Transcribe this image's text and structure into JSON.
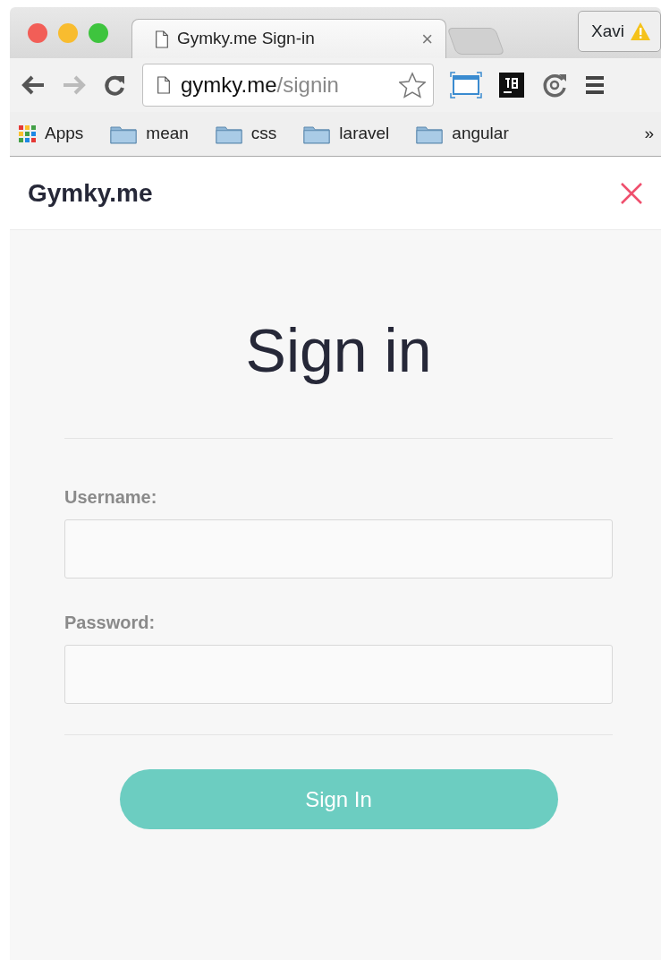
{
  "browser": {
    "tab": {
      "title": "Gymky.me Sign-in",
      "close": "×"
    },
    "profile": {
      "name": "Xavi"
    },
    "address": {
      "host": "gymky.me",
      "path": "/signin"
    },
    "bookmarks": [
      {
        "kind": "apps",
        "label": "Apps"
      },
      {
        "kind": "folder",
        "label": "mean"
      },
      {
        "kind": "folder",
        "label": "css"
      },
      {
        "kind": "folder",
        "label": "laravel"
      },
      {
        "kind": "folder",
        "label": "angular"
      }
    ],
    "overflow": "»"
  },
  "header": {
    "brand": "Gymky.me"
  },
  "form": {
    "title": "Sign in",
    "fields": [
      {
        "label": "Username:"
      },
      {
        "label": "Password:"
      }
    ],
    "submit": "Sign In"
  }
}
